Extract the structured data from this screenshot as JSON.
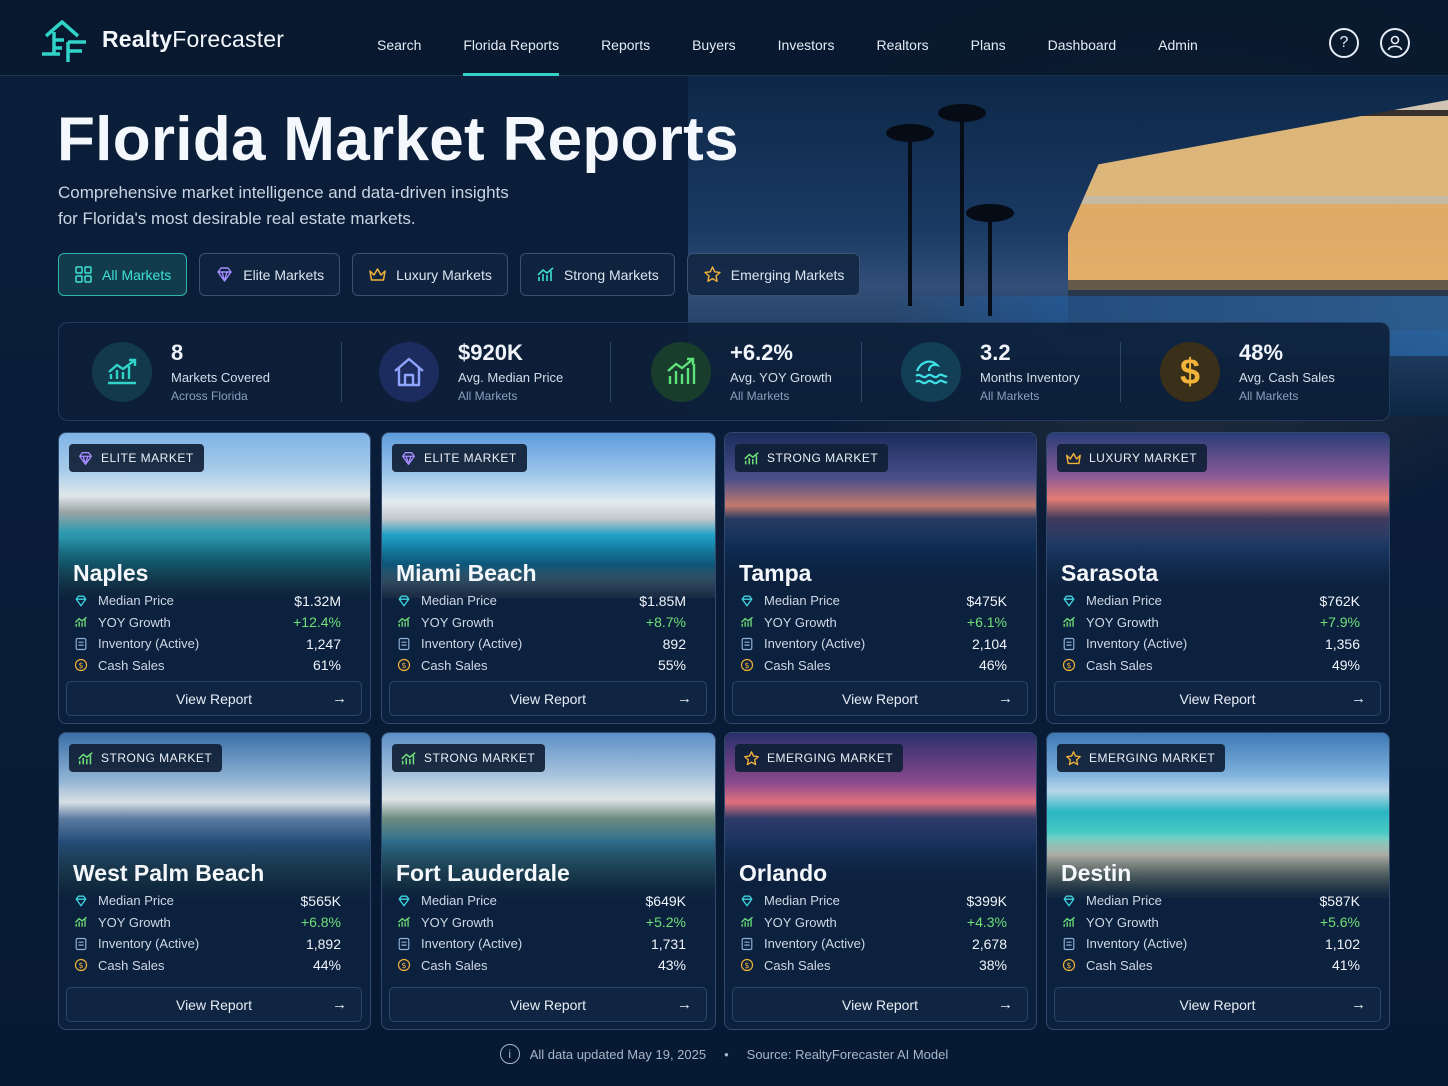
{
  "brand": {
    "name_bold": "Realty",
    "name_rest": "Forecaster"
  },
  "nav": [
    "Search",
    "Florida Reports",
    "Reports",
    "Buyers",
    "Investors",
    "Realtors",
    "Plans",
    "Dashboard",
    "Admin"
  ],
  "nav_active": "Florida Reports",
  "header_icons": [
    "help-icon",
    "user-icon"
  ],
  "hero": {
    "title": "Florida Market Reports",
    "subtitle_line1": "Comprehensive market intelligence and data-driven insights",
    "subtitle_line2": "for Florida's most desirable real estate markets."
  },
  "filters": [
    {
      "label": "All Markets",
      "icon": "grid-icon",
      "active": true
    },
    {
      "label": "Elite Markets",
      "icon": "diamond-icon",
      "active": false
    },
    {
      "label": "Luxury Markets",
      "icon": "crown-icon",
      "active": false
    },
    {
      "label": "Strong Markets",
      "icon": "bar-chart-icon",
      "active": false
    },
    {
      "label": "Emerging Markets",
      "icon": "star-icon",
      "active": false
    }
  ],
  "stats": [
    {
      "value": "8",
      "label": "Markets Covered",
      "sub": "Across Florida",
      "icon": "trend-icon",
      "color": "#2fd3c7"
    },
    {
      "value": "$920K",
      "label": "Avg. Median Price",
      "sub": "All Markets",
      "icon": "house-icon",
      "color": "#6f8bff"
    },
    {
      "value": "+6.2%",
      "label": "Avg. YOY Growth",
      "sub": "All Markets",
      "icon": "growth-chart-icon",
      "color": "#5ee07a"
    },
    {
      "value": "3.2",
      "label": "Months Inventory",
      "sub": "All Markets",
      "icon": "wave-icon",
      "color": "#3ee0e6"
    },
    {
      "value": "48%",
      "label": "Avg. Cash Sales",
      "sub": "All Markets",
      "icon": "dollar-icon",
      "color": "#f2b33a"
    }
  ],
  "metric_labels": {
    "price": "Median Price",
    "growth": "YOY Growth",
    "inventory": "Inventory (Active)",
    "cash": "Cash Sales"
  },
  "view_label": "View Report",
  "markets": [
    {
      "tier": "ELITE MARKET",
      "tier_icon": "diamond-icon",
      "city": "Naples",
      "price": "$1.32M",
      "growth": "+12.4%",
      "inventory": "1,247",
      "cash": "61%"
    },
    {
      "tier": "ELITE MARKET",
      "tier_icon": "diamond-icon",
      "city": "Miami Beach",
      "price": "$1.85M",
      "growth": "+8.7%",
      "inventory": "892",
      "cash": "55%"
    },
    {
      "tier": "STRONG MARKET",
      "tier_icon": "bar-chart-icon",
      "city": "Tampa",
      "price": "$475K",
      "growth": "+6.1%",
      "inventory": "2,104",
      "cash": "46%"
    },
    {
      "tier": "LUXURY MARKET",
      "tier_icon": "crown-icon",
      "city": "Sarasota",
      "price": "$762K",
      "growth": "+7.9%",
      "inventory": "1,356",
      "cash": "49%"
    },
    {
      "tier": "STRONG MARKET",
      "tier_icon": "bar-chart-icon",
      "city": "West Palm Beach",
      "price": "$565K",
      "growth": "+6.8%",
      "inventory": "1,892",
      "cash": "44%"
    },
    {
      "tier": "STRONG MARKET",
      "tier_icon": "bar-chart-icon",
      "city": "Fort Lauderdale",
      "price": "$649K",
      "growth": "+5.2%",
      "inventory": "1,731",
      "cash": "43%"
    },
    {
      "tier": "EMERGING MARKET",
      "tier_icon": "star-icon",
      "city": "Orlando",
      "price": "$399K",
      "growth": "+4.3%",
      "inventory": "2,678",
      "cash": "38%"
    },
    {
      "tier": "EMERGING MARKET",
      "tier_icon": "star-icon",
      "city": "Destin",
      "price": "$587K",
      "growth": "+5.6%",
      "inventory": "1,102",
      "cash": "41%"
    }
  ],
  "footer": {
    "updated": "All data updated May 19, 2025",
    "separator": "•",
    "source": "Source: RealtyForecaster AI Model"
  }
}
